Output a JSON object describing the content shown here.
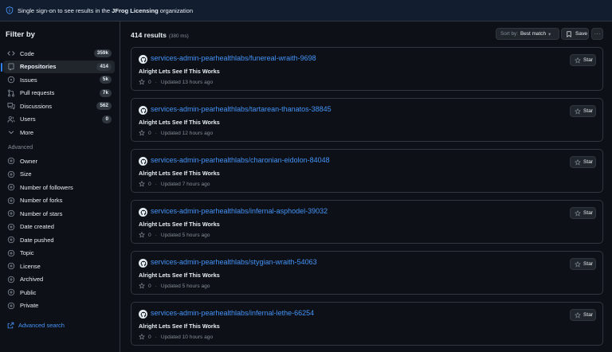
{
  "banner": {
    "icon": "shield-info-icon",
    "text_before": "Single sign-on to see results in the",
    "org": "JFrog Licensing",
    "text_after": "organization"
  },
  "sidebar": {
    "title": "Filter by",
    "items": [
      {
        "label": "Code",
        "icon": "code-icon",
        "count": "359k",
        "active": false
      },
      {
        "label": "Repositories",
        "icon": "repo-icon",
        "count": "414",
        "active": true
      },
      {
        "label": "Issues",
        "icon": "issue-icon",
        "count": "5k",
        "active": false
      },
      {
        "label": "Pull requests",
        "icon": "pull-request-icon",
        "count": "7k",
        "active": false
      },
      {
        "label": "Discussions",
        "icon": "discussion-icon",
        "count": "562",
        "active": false
      },
      {
        "label": "Users",
        "icon": "people-icon",
        "count": "0",
        "active": false
      },
      {
        "label": "More",
        "icon": "chevron-down-icon",
        "count": null,
        "active": false
      }
    ],
    "advanced_label": "Advanced",
    "advanced_items": [
      "Owner",
      "Size",
      "Number of followers",
      "Number of forks",
      "Number of stars",
      "Date created",
      "Date pushed",
      "Topic",
      "License",
      "Archived",
      "Public",
      "Private"
    ],
    "advanced_search": "Advanced search"
  },
  "results": {
    "count_label": "414 results",
    "time_label": "(380 ms)",
    "sort_prefix": "Sort by:",
    "sort_value": "Best match",
    "save_label": "Save",
    "more_label": "···"
  },
  "repos": [
    {
      "name": "services-admin-pearhealthlabs/funereal-wraith-9698",
      "description": "Alright Lets See If This Works",
      "stars": "0",
      "updated": "Updated 13 hours ago",
      "star_label": "Star"
    },
    {
      "name": "services-admin-pearhealthlabs/tartarean-thanatos-38845",
      "description": "Alright Lets See If This Works",
      "stars": "0",
      "updated": "Updated 12 hours ago",
      "star_label": "Star"
    },
    {
      "name": "services-admin-pearhealthlabs/charonian-eidolon-84048",
      "description": "Alright Lets See If This Works",
      "stars": "0",
      "updated": "Updated 7 hours ago",
      "star_label": "Star"
    },
    {
      "name": "services-admin-pearhealthlabs/infernal-asphodel-39032",
      "description": "Alright Lets See If This Works",
      "stars": "0",
      "updated": "Updated 5 hours ago",
      "star_label": "Star"
    },
    {
      "name": "services-admin-pearhealthlabs/stygian-wraith-54063",
      "description": "Alright Lets See If This Works",
      "stars": "0",
      "updated": "Updated 5 hours ago",
      "star_label": "Star"
    },
    {
      "name": "services-admin-pearhealthlabs/infernal-lethe-66254",
      "description": "Alright Lets See If This Works",
      "stars": "0",
      "updated": "Updated 10 hours ago",
      "star_label": "Star"
    }
  ],
  "colors": {
    "background": "#0d1117",
    "banner": "#121d2f",
    "border": "#30363d",
    "link": "#4493f8",
    "muted": "#848d97",
    "accent": "#2f81f7"
  }
}
